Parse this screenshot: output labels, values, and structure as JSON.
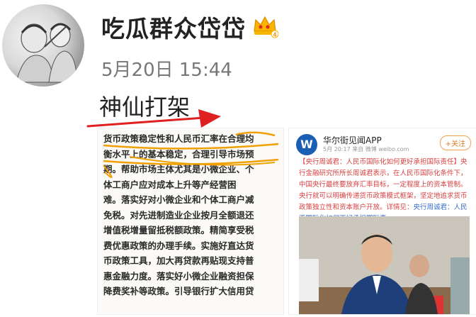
{
  "post": {
    "username": "吃瓜群众岱岱",
    "vip_badge_level": "4",
    "timestamp": "5月20日 15:44",
    "text": "神仙打架"
  },
  "images": {
    "left_lines": [
      "货币政策稳定性和人民币汇率在合理均",
      "衡水平上的基本稳定，合理引导市场预",
      "期。帮助市场主体尤其是小微企业、个",
      "体工商户应对成本上升等产经营困",
      "难。落实好对小微企业和个体工商户减",
      "免税。对先进制造业企业按月全额退还",
      "增值税增量留抵税额政策。精简享受税",
      "费优惠政策的办理手续。实施好直达货",
      "币政策工具，加大再贷款再贴现支持普",
      "惠金融力度。落实好小微企业融资担保",
      "降费奖补等政策。引导银行扩大信用贷"
    ],
    "right": {
      "logo": "W",
      "account_name": "华尔街见闻APP",
      "meta": "5月 20:17 来自 微博 weibo.com",
      "follow_label": "+关注",
      "body_text": "【央行周诚君：人民币国际化如何更好承担国际责任】央行金融研究所所长周诚君表示，在人民币国际化条件下，中国央行最终要放弃汇率目标，一定程度上的资本管制。央行就可以明确传递货币政策模式框架，坚定地追求货币政策独立性和资本账户开放。详情见：",
      "link_text": "央行周诚君：人民币国际化如何更好承担国际责"
    }
  },
  "colors": {
    "username": "#222222",
    "timestamp": "#777777",
    "arrow": "#e02020",
    "underline": "#f0a000",
    "right_body_text": "#d94040",
    "link": "#3a6fd1"
  }
}
